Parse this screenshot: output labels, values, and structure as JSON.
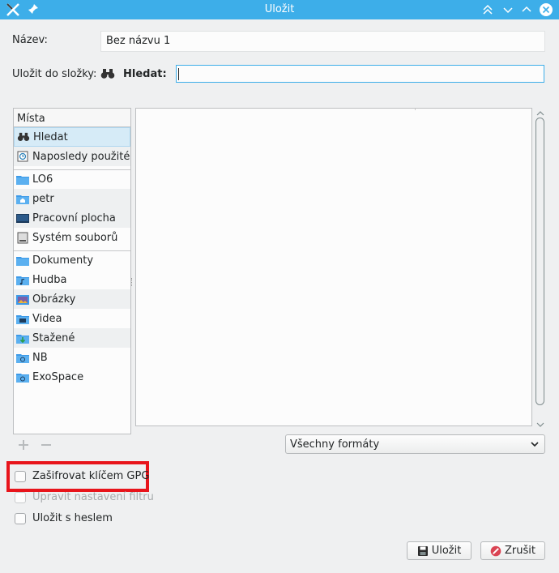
{
  "window": {
    "title": "Uložit"
  },
  "form": {
    "name_label": "Název:",
    "name_value": "Bez názvu 1",
    "folder_label": "Uložit do složky:",
    "search_label": "Hledat:",
    "search_value": ""
  },
  "places": {
    "header": "Místa",
    "items": [
      {
        "label": "Hledat",
        "icon": "binoculars-icon"
      },
      {
        "label": "Naposledy použité",
        "icon": "recent-icon"
      },
      {
        "label": "LO6",
        "icon": "folder-icon"
      },
      {
        "label": "petr",
        "icon": "home-folder-icon"
      },
      {
        "label": "Pracovní plocha",
        "icon": "desktop-icon"
      },
      {
        "label": "Systém souborů",
        "icon": "drive-icon"
      },
      {
        "label": "Dokumenty",
        "icon": "folder-icon"
      },
      {
        "label": "Hudba",
        "icon": "music-folder-icon"
      },
      {
        "label": "Obrázky",
        "icon": "pictures-folder-icon"
      },
      {
        "label": "Videa",
        "icon": "video-folder-icon"
      },
      {
        "label": "Stažené",
        "icon": "download-folder-icon"
      },
      {
        "label": "NB",
        "icon": "network-folder-icon"
      },
      {
        "label": "ExoSpace",
        "icon": "network-folder-icon"
      }
    ]
  },
  "filter": {
    "selected": "Všechny formáty"
  },
  "options": {
    "encrypt_gpg": "Zašifrovat klíčem GPG",
    "edit_filter": "Upravit nastavení filtru",
    "save_password": "Uložit s heslem"
  },
  "buttons": {
    "save": "Uložit",
    "cancel": "Zrušit"
  },
  "colors": {
    "titlebar": "#3daee9",
    "highlight": "#e8141b",
    "folder": "#3d9ae8"
  }
}
